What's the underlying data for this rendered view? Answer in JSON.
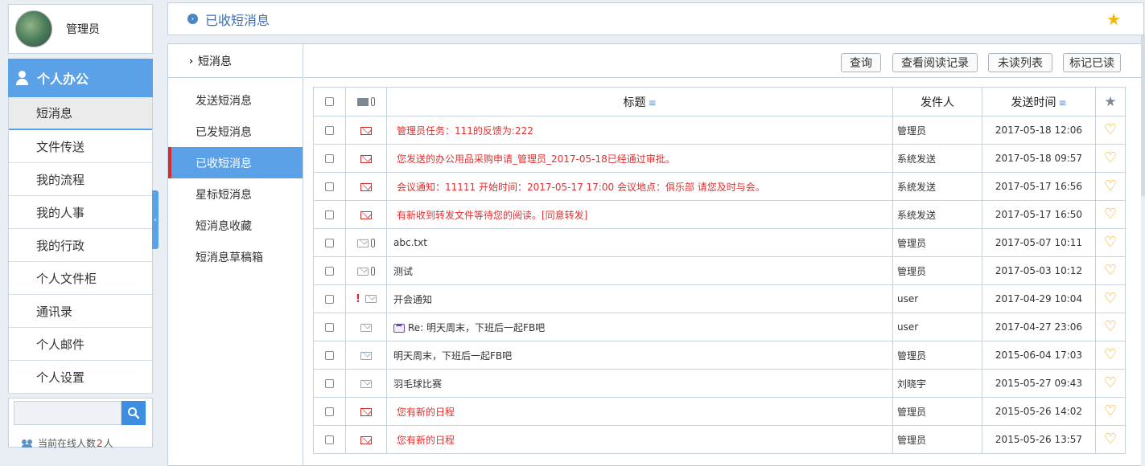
{
  "user": {
    "name": "管理员"
  },
  "nav": {
    "header": "个人办公",
    "items": [
      {
        "label": "短消息",
        "active": true
      },
      {
        "label": "文件传送"
      },
      {
        "label": "我的流程"
      },
      {
        "label": "我的人事"
      },
      {
        "label": "我的行政"
      },
      {
        "label": "个人文件柜"
      },
      {
        "label": "通讯录"
      },
      {
        "label": "个人邮件"
      },
      {
        "label": "个人设置"
      }
    ]
  },
  "search": {
    "placeholder": "",
    "value": ""
  },
  "online": {
    "prefix": "当前在线人数",
    "count": "2",
    "suffix": "人"
  },
  "topbar": {
    "title": "已收短消息"
  },
  "subnav": {
    "header": "短消息",
    "items": [
      {
        "label": "发送短消息"
      },
      {
        "label": "已发短消息"
      },
      {
        "label": "已收短消息",
        "active": true
      },
      {
        "label": "星标短消息"
      },
      {
        "label": "短消息收藏"
      },
      {
        "label": "短消息草稿箱"
      }
    ]
  },
  "toolbar": {
    "query": "查询",
    "view_read": "查看阅读记录",
    "unread_list": "未读列表",
    "mark_read": "标记已读"
  },
  "table": {
    "headers": {
      "title": "标题",
      "from": "发件人",
      "time": "发送时间"
    },
    "rows": [
      {
        "title": "管理员任务：111的反馈为:222",
        "from": "管理员",
        "time": "2017-05-18 12:06",
        "unread": true,
        "attach": false,
        "urgent": false,
        "reply": false
      },
      {
        "title": "您发送的办公用品采购申请_管理员_2017-05-18已经通过审批。",
        "from": "系统发送",
        "time": "2017-05-18 09:57",
        "unread": true,
        "attach": false,
        "urgent": false,
        "reply": false
      },
      {
        "title": "会议通知：11111 开始时间：2017-05-17 17:00 会议地点：俱乐部 请您及时与会。",
        "from": "系统发送",
        "time": "2017-05-17 16:56",
        "unread": true,
        "attach": false,
        "urgent": false,
        "reply": false
      },
      {
        "title": "有新收到转发文件等待您的阅读。[同意转发]",
        "from": "系统发送",
        "time": "2017-05-17 16:50",
        "unread": true,
        "attach": false,
        "urgent": false,
        "reply": false
      },
      {
        "title": "abc.txt",
        "from": "管理员",
        "time": "2017-05-07 10:11",
        "unread": false,
        "attach": true,
        "urgent": false,
        "reply": false
      },
      {
        "title": "测试",
        "from": "管理员",
        "time": "2017-05-03 10:12",
        "unread": false,
        "attach": true,
        "urgent": false,
        "reply": false
      },
      {
        "title": "开会通知",
        "from": "user",
        "time": "2017-04-29 10:04",
        "unread": false,
        "attach": false,
        "urgent": true,
        "reply": false
      },
      {
        "title": "Re: 明天周末，下班后一起FB吧",
        "from": "user",
        "time": "2017-04-27 23:06",
        "unread": false,
        "attach": false,
        "urgent": false,
        "reply": true
      },
      {
        "title": "明天周末，下班后一起FB吧",
        "from": "管理员",
        "time": "2015-06-04 17:03",
        "unread": false,
        "attach": false,
        "urgent": false,
        "reply": false
      },
      {
        "title": "羽毛球比赛",
        "from": "刘晓宇",
        "time": "2015-05-27 09:43",
        "unread": false,
        "attach": false,
        "urgent": false,
        "reply": false
      },
      {
        "title": "您有新的日程",
        "from": "管理员",
        "time": "2015-05-26 14:02",
        "unread": true,
        "attach": false,
        "urgent": false,
        "reply": false
      },
      {
        "title": "您有新的日程",
        "from": "管理员",
        "time": "2015-05-26 13:57",
        "unread": true,
        "attach": false,
        "urgent": false,
        "reply": false
      }
    ]
  },
  "colors": {
    "accent": "#5aa1e8",
    "unread": "#e03030",
    "star": "#f2b707",
    "heart": "#f0a500"
  },
  "icons": {
    "envelope": "envelope-icon",
    "attachment": "paperclip-icon",
    "favorite": "heart-icon",
    "star": "star-icon",
    "search": "search-icon"
  }
}
